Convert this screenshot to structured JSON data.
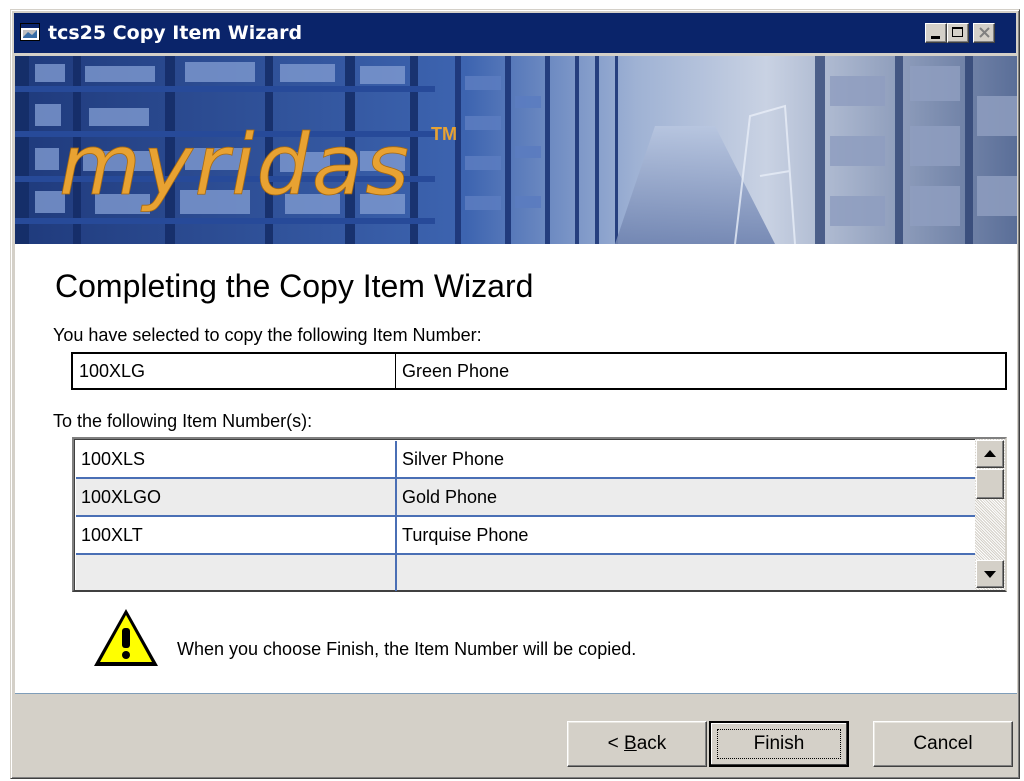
{
  "window": {
    "title": "tcs25 Copy Item Wizard"
  },
  "banner": {
    "logo_text": "myridas",
    "trademark": "TM"
  },
  "page": {
    "heading": "Completing the Copy Item Wizard",
    "source_label": "You have selected to copy the following Item Number:",
    "source": {
      "item_number": "100XLG",
      "description": "Green Phone"
    },
    "target_label": "To the following Item Number(s):",
    "targets": [
      {
        "item_number": "100XLS",
        "description": "Silver Phone"
      },
      {
        "item_number": "100XLGO",
        "description": "Gold Phone"
      },
      {
        "item_number": "100XLT",
        "description": "Turquise Phone"
      },
      {
        "item_number": "",
        "description": ""
      }
    ],
    "warning_text": "When you choose Finish, the Item Number will be copied."
  },
  "buttons": {
    "back_prefix": "< ",
    "back_mnemonic": "B",
    "back_rest": "ack",
    "finish": "Finish",
    "cancel": "Cancel"
  },
  "colors": {
    "titlebar": "#0a246a",
    "grid_line": "#4a6fb5",
    "logo": "#e8a232",
    "dialog_face": "#d4d0c8"
  },
  "icons": {
    "app": "window-icon",
    "warning": "warning-icon",
    "minimize": "minimize-icon",
    "maximize": "maximize-icon",
    "close": "close-icon",
    "scroll_up": "arrow-up-icon",
    "scroll_down": "arrow-down-icon"
  }
}
